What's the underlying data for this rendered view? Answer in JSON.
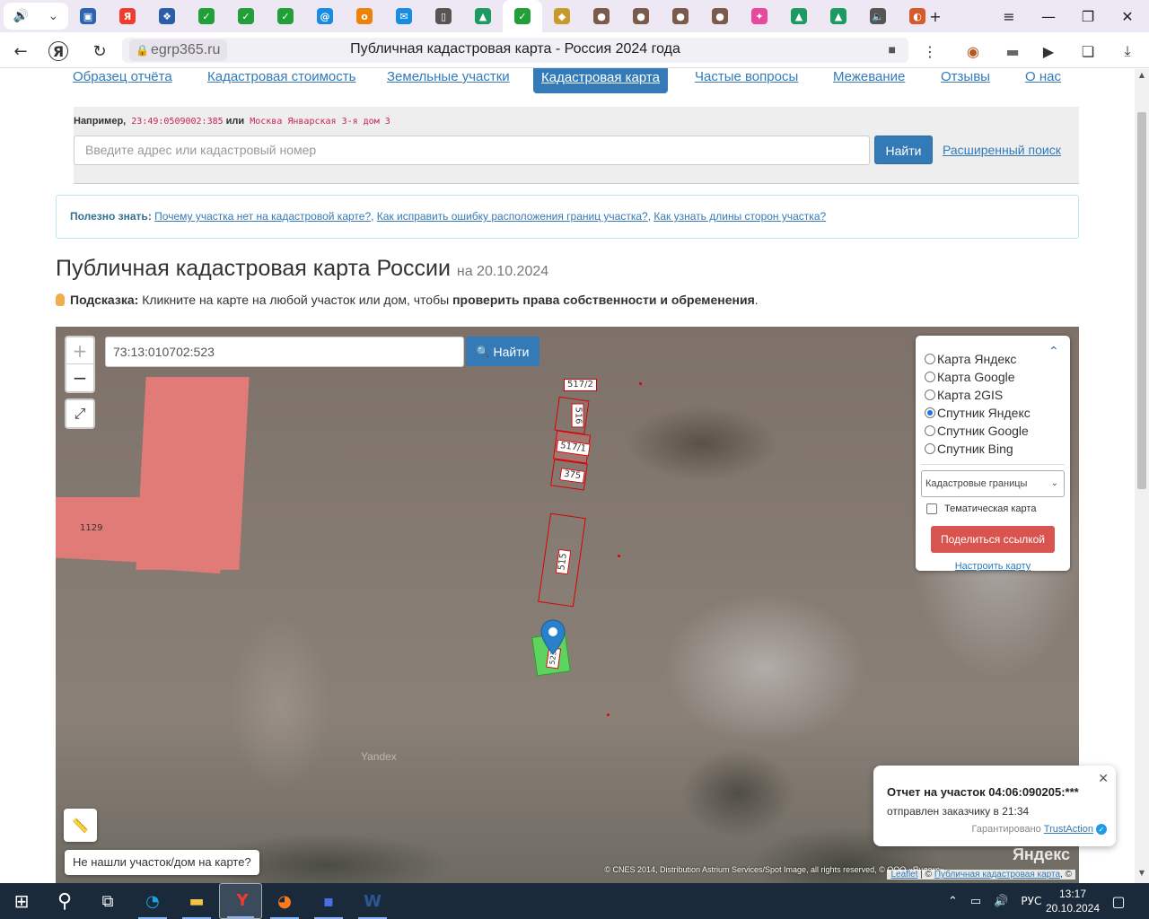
{
  "browser": {
    "tabs": [
      {
        "icon": "speaker-icon",
        "label": "🔊",
        "color": "#555555"
      },
      {
        "icon": "chevron-down-icon",
        "label": "⌄",
        "color": "#555555"
      },
      {
        "icon": "yandex-market-icon",
        "label": "▣",
        "color": "#2a64b3"
      },
      {
        "icon": "yandex-icon",
        "label": "Я",
        "color": "#f23b2f"
      },
      {
        "icon": "gosuslugi-icon",
        "label": "❖",
        "color": "#2b5ea8"
      },
      {
        "icon": "sber-icon",
        "label": "✓",
        "color": "#21a038"
      },
      {
        "icon": "sber-icon",
        "label": "✓",
        "color": "#21a038"
      },
      {
        "icon": "sber-icon",
        "label": "✓",
        "color": "#21a038"
      },
      {
        "icon": "mail-at-icon",
        "label": "@",
        "color": "#168de2"
      },
      {
        "icon": "ok-icon",
        "label": "о",
        "color": "#ee8208"
      },
      {
        "icon": "mail-icon",
        "label": "✉",
        "color": "#168de2"
      },
      {
        "icon": "document-icon",
        "label": "▯",
        "color": "#555555"
      },
      {
        "icon": "rosreestr-icon",
        "label": "▲",
        "color": "#1b9a62"
      },
      {
        "icon": "check-circle-icon",
        "label": "✓",
        "color": "#21a038"
      },
      {
        "icon": "emblem-icon",
        "label": "◆",
        "color": "#c89a2b"
      },
      {
        "icon": "avatar-icon",
        "label": "●",
        "color": "#7a5a4a"
      },
      {
        "icon": "avatar-icon",
        "label": "●",
        "color": "#7a5a4a"
      },
      {
        "icon": "avatar-icon",
        "label": "●",
        "color": "#7a5a4a"
      },
      {
        "icon": "avatar-icon",
        "label": "●",
        "color": "#7a5a4a"
      },
      {
        "icon": "puzzle-icon",
        "label": "✦",
        "color": "#e84a9b"
      },
      {
        "icon": "rosreestr-icon",
        "label": "▲",
        "color": "#1b9a62"
      },
      {
        "icon": "rosreestr-icon",
        "label": "▲",
        "color": "#1b9a62"
      },
      {
        "icon": "speaker-icon",
        "label": "🔈",
        "color": "#555555"
      },
      {
        "icon": "globe-icon",
        "label": "◐",
        "color": "#d8592b"
      }
    ],
    "new_tab": "+",
    "menu": "≡",
    "minimize": "—",
    "restore": "❐",
    "close": "✕",
    "back": "←",
    "yandex_logo": "Я",
    "reload": "↻",
    "url_host": "egrp365.ru",
    "page_title": "Публичная кадастровая карта - Россия 2024 года",
    "more": "⋮",
    "download": "⤓"
  },
  "nav": {
    "items": [
      {
        "label": "Образец отчёта",
        "active": false
      },
      {
        "label": "Кадастровая стоимость",
        "active": false
      },
      {
        "label": "Земельные участки",
        "active": false
      },
      {
        "label": "Кадастровая карта",
        "active": true
      },
      {
        "label": "Частые вопросы",
        "active": false
      },
      {
        "label": "Межевание",
        "active": false
      },
      {
        "label": "Отзывы",
        "active": false
      },
      {
        "label": "О нас",
        "active": false
      }
    ]
  },
  "search": {
    "example_prefix": "Например,",
    "example_1": "23:49:0509002:385",
    "example_or": "или",
    "example_2": "Москва Январская 3-я дом 3",
    "placeholder": "Введите адрес или кадастровый номер",
    "button": "Найти",
    "advanced": "Расширенный поиск"
  },
  "useful": {
    "label": "Полезно знать:",
    "links": [
      "Почему участка нет на кадастровой карте?",
      "Как исправить ошибку расположения границ участка?",
      "Как узнать длины сторон участка?"
    ]
  },
  "heading": {
    "title": "Публичная кадастровая карта России",
    "date": "на 20.10.2024"
  },
  "hint": {
    "label": "Подсказка:",
    "text": "Кликните на карте на любой участок или дом, чтобы",
    "bold": "проверить права собственности и обременения",
    "end": "."
  },
  "map": {
    "zoom_in": "+",
    "zoom_out": "−",
    "fullscreen": "⤢",
    "search_value": "73:13:010702:523",
    "find_icon": "🔍",
    "find_label": "Найти",
    "layers": [
      {
        "label": "Карта Яндекс",
        "checked": false
      },
      {
        "label": "Карта Google",
        "checked": false
      },
      {
        "label": "Карта 2GIS",
        "checked": false
      },
      {
        "label": "Спутник Яндекс",
        "checked": true
      },
      {
        "label": "Спутник Google",
        "checked": false
      },
      {
        "label": "Спутник Bing",
        "checked": false
      }
    ],
    "collapse": "⌃",
    "boundaries_select": "Кадастровые границы",
    "select_caret": "⌄",
    "thematic": "Тематическая карта",
    "share": "Поделиться ссылкой",
    "configure": "Настроить карту",
    "not_found": "Не нашли участок/дом на карте?",
    "ruler": "📏",
    "parcels": [
      {
        "label": "517/2"
      },
      {
        "label": "516"
      },
      {
        "label": "517/1"
      },
      {
        "label": "375"
      },
      {
        "label": "515"
      },
      {
        "label": "523"
      },
      {
        "label": "1129"
      }
    ],
    "watermark": "Yandex",
    "yandex_logo": "Яндекс",
    "attribution_imagery": "© CNES 2014, Distribution Astrium Services/Spot Image, all rights reserved, © ООО «Яндекс»",
    "attribution_leaflet": "Leaflet",
    "attribution_sep": "| ©",
    "attribution_pkk": "Публичная кадастровая карта",
    "attribution_end": ", ©",
    "marker_color": "#2a81cb",
    "selected_parcel_color": "#5fd35f",
    "building_color": "#e07b78"
  },
  "notification": {
    "title": "Отчет на участок 04:06:090205:***",
    "subtitle": "отправлен заказчику в 21:34",
    "guarantee": "Гарантировано",
    "provider": "TrustAction",
    "verified": "✓",
    "close": "✕"
  },
  "taskbar": {
    "start": "⊞",
    "search": "⚲",
    "taskview": "⧉",
    "apps": [
      {
        "icon": "edge-icon",
        "label": "◔",
        "color": "#1aa3e0"
      },
      {
        "icon": "folder-icon",
        "label": "▬",
        "color": "#f5c242"
      },
      {
        "icon": "yandex-browser-icon",
        "label": "Y",
        "color": "#f23b2f"
      },
      {
        "icon": "firefox-icon",
        "label": "◕",
        "color": "#ff7a1a"
      },
      {
        "icon": "floppy-icon",
        "label": "▪",
        "color": "#4a6fe3"
      },
      {
        "icon": "word-icon",
        "label": "W",
        "color": "#2b5797"
      }
    ],
    "tray_up": "⌃",
    "tray_network": "▭",
    "tray_volume": "🔊",
    "lang": "РУС",
    "time": "13:17",
    "date": "20.10.2024",
    "notifications": "▢"
  }
}
